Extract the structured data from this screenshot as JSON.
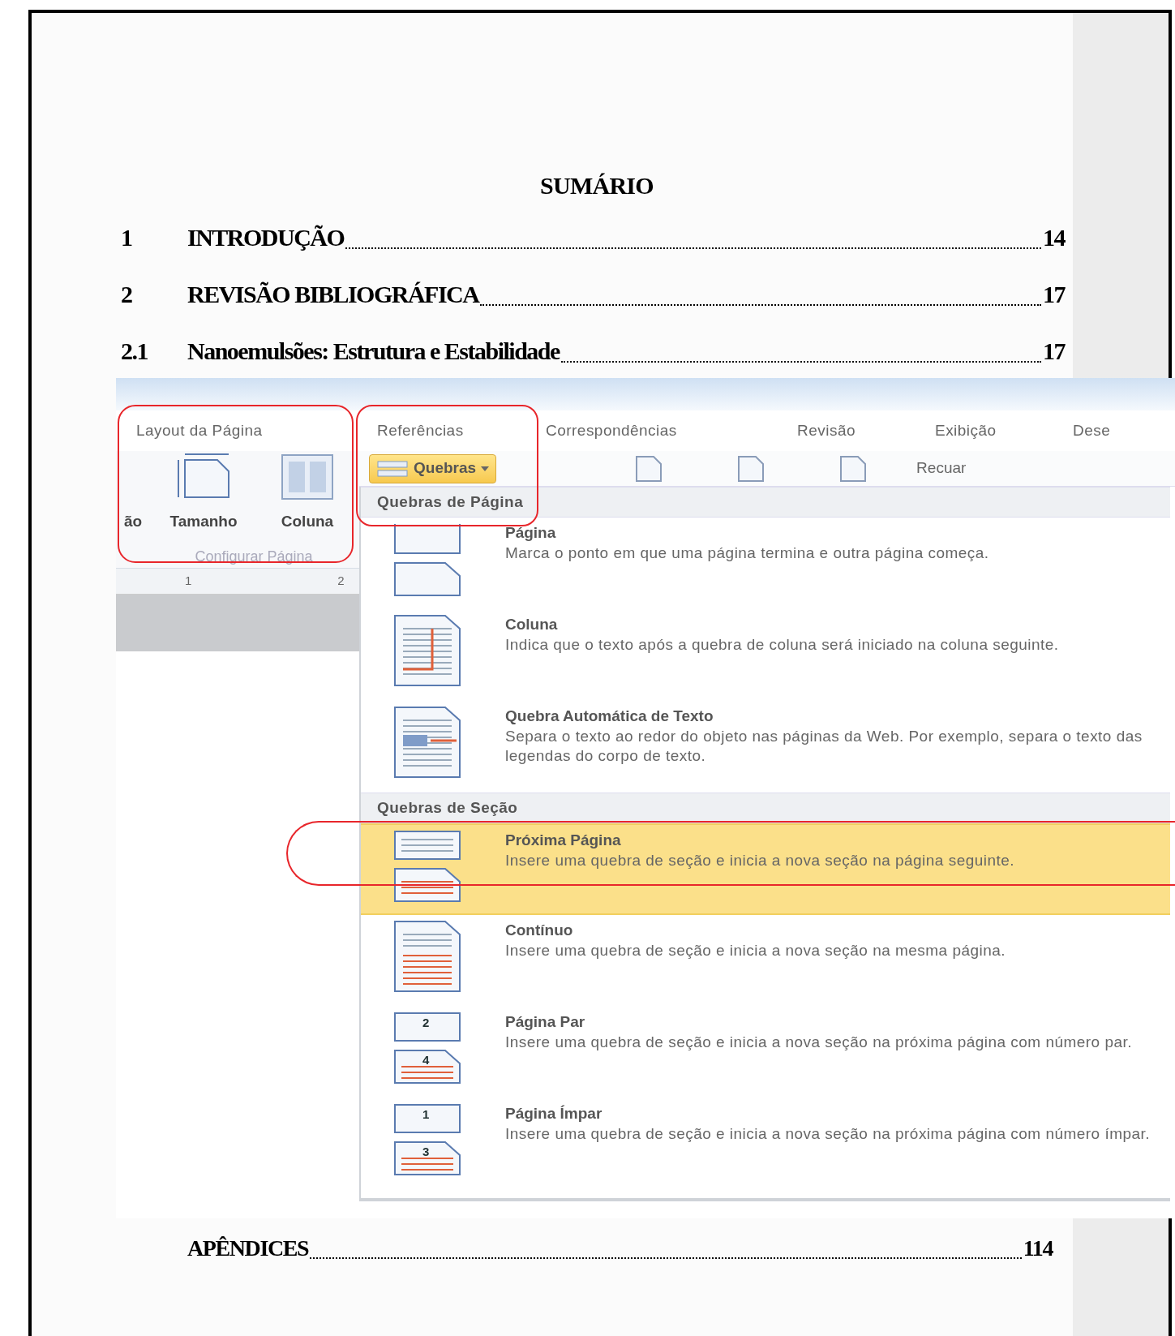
{
  "document": {
    "title": "SUMÁRIO",
    "toc": [
      {
        "number": "1",
        "title": "INTRODUÇÃO",
        "page": "14"
      },
      {
        "number": "2",
        "title": "REVISÃO BIBLIOGRÁFICA",
        "page": "17"
      },
      {
        "number": "2.1",
        "title": "Nanoemulsões: Estrutura e Estabilidade",
        "page": "17"
      }
    ],
    "toc_after": [
      {
        "title": "APÊNDICES",
        "page": "114"
      }
    ]
  },
  "screenshot": {
    "tabs": [
      "Layout da Página",
      "Referências",
      "Correspondências",
      "Revisão",
      "Exibição",
      "Dese"
    ],
    "ribbon_buttons": [
      {
        "label": "ão",
        "kind": "none"
      },
      {
        "label": "Tamanho",
        "kind": "size"
      },
      {
        "label": "Coluna",
        "kind": "columns"
      }
    ],
    "group_label": "Configurar Página",
    "ruler": [
      "1",
      "2"
    ],
    "breaks_button": "Quebras",
    "toolbar_label": "Recuar",
    "menu": [
      {
        "heading": "Quebras de Página",
        "items": [
          {
            "kind": "page",
            "title": "Página",
            "description": "Marca o ponto em que uma página termina e outra página começa.",
            "selected": false
          },
          {
            "kind": "column",
            "title": "Coluna",
            "description": "Indica que o texto após a quebra de coluna será iniciado na coluna seguinte.",
            "selected": false
          },
          {
            "kind": "wrap",
            "title": "Quebra Automática de Texto",
            "description": "Separa o texto ao redor do objeto nas páginas da Web. Por exemplo, separa o texto das legendas do corpo de texto.",
            "selected": false
          }
        ]
      },
      {
        "heading": "Quebras de Seção",
        "items": [
          {
            "kind": "next",
            "title": "Próxima Página",
            "description": "Insere uma quebra de seção e inicia a nova seção na página seguinte.",
            "selected": true
          },
          {
            "kind": "continuous",
            "title": "Contínuo",
            "description": "Insere uma quebra de seção e inicia a nova seção na mesma página.",
            "selected": false
          },
          {
            "kind": "numbered",
            "numbers": [
              "2",
              "4"
            ],
            "title": "Página Par",
            "description": "Insere uma quebra de seção e inicia a nova seção na próxima página com número par.",
            "selected": false
          },
          {
            "kind": "numbered",
            "numbers": [
              "1",
              "3"
            ],
            "title": "Página Ímpar",
            "description": "Insere uma quebra de seção e inicia a nova seção na próxima página com número ímpar.",
            "selected": false
          }
        ]
      }
    ]
  }
}
